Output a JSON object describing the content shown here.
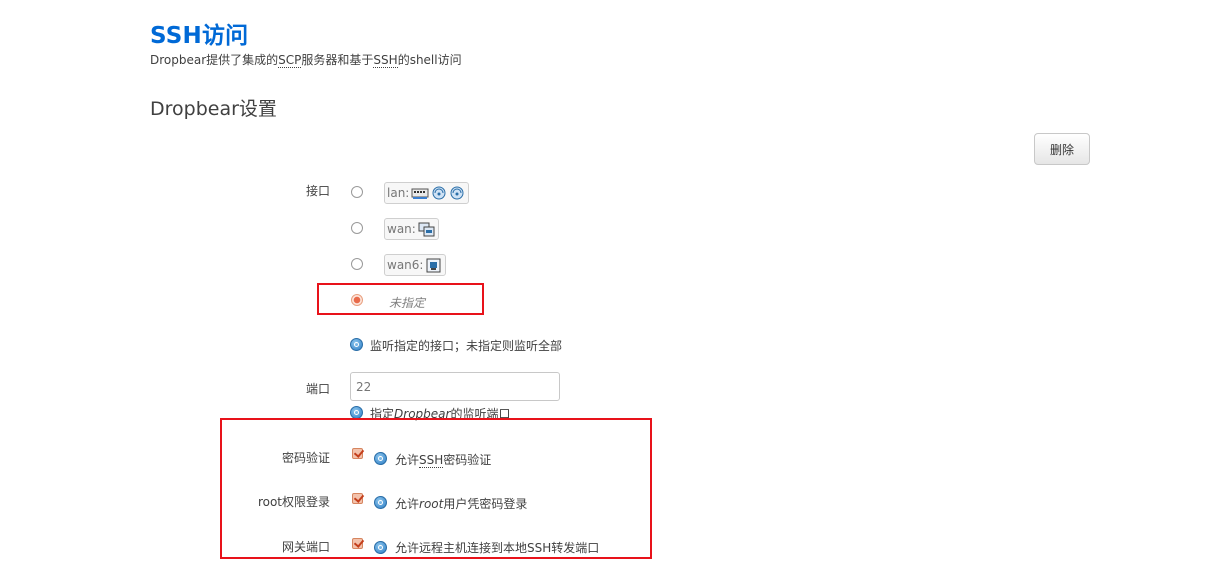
{
  "header": {
    "title": "SSH访问",
    "subtitle_prefix": "Dropbear提供了集成的",
    "subtitle_abbr1": "SCP",
    "subtitle_mid": "服务器和基于",
    "subtitle_abbr2": "SSH",
    "subtitle_suffix": "的shell访问"
  },
  "section": {
    "title": "Dropbear设置",
    "delete_label": "删除"
  },
  "interface": {
    "label": "接口",
    "options": [
      {
        "name": "lan:",
        "selected": false
      },
      {
        "name": "wan:",
        "selected": false
      },
      {
        "name": "wan6:",
        "selected": false
      }
    ],
    "unspecified_label": "未指定",
    "unspecified_selected": true,
    "help": "监听指定的接口；未指定则监听全部"
  },
  "port": {
    "label": "端口",
    "value": "22",
    "help_prefix": "指定",
    "help_italic": "Dropbear",
    "help_suffix": "的监听端口"
  },
  "password_auth": {
    "label": "密码验证",
    "checked": true,
    "help_prefix": "允许",
    "help_abbr": "SSH",
    "help_suffix": "密码验证"
  },
  "root_login": {
    "label": "root权限登录",
    "checked": true,
    "help_prefix": "允许",
    "help_italic": "root",
    "help_suffix": "用户凭密码登录"
  },
  "gateway_ports": {
    "label": "网关端口",
    "checked": true,
    "help": "允许远程主机连接到本地SSH转发端口"
  },
  "colors": {
    "title": "#0069d6",
    "highlight_box": "#e8121a"
  }
}
